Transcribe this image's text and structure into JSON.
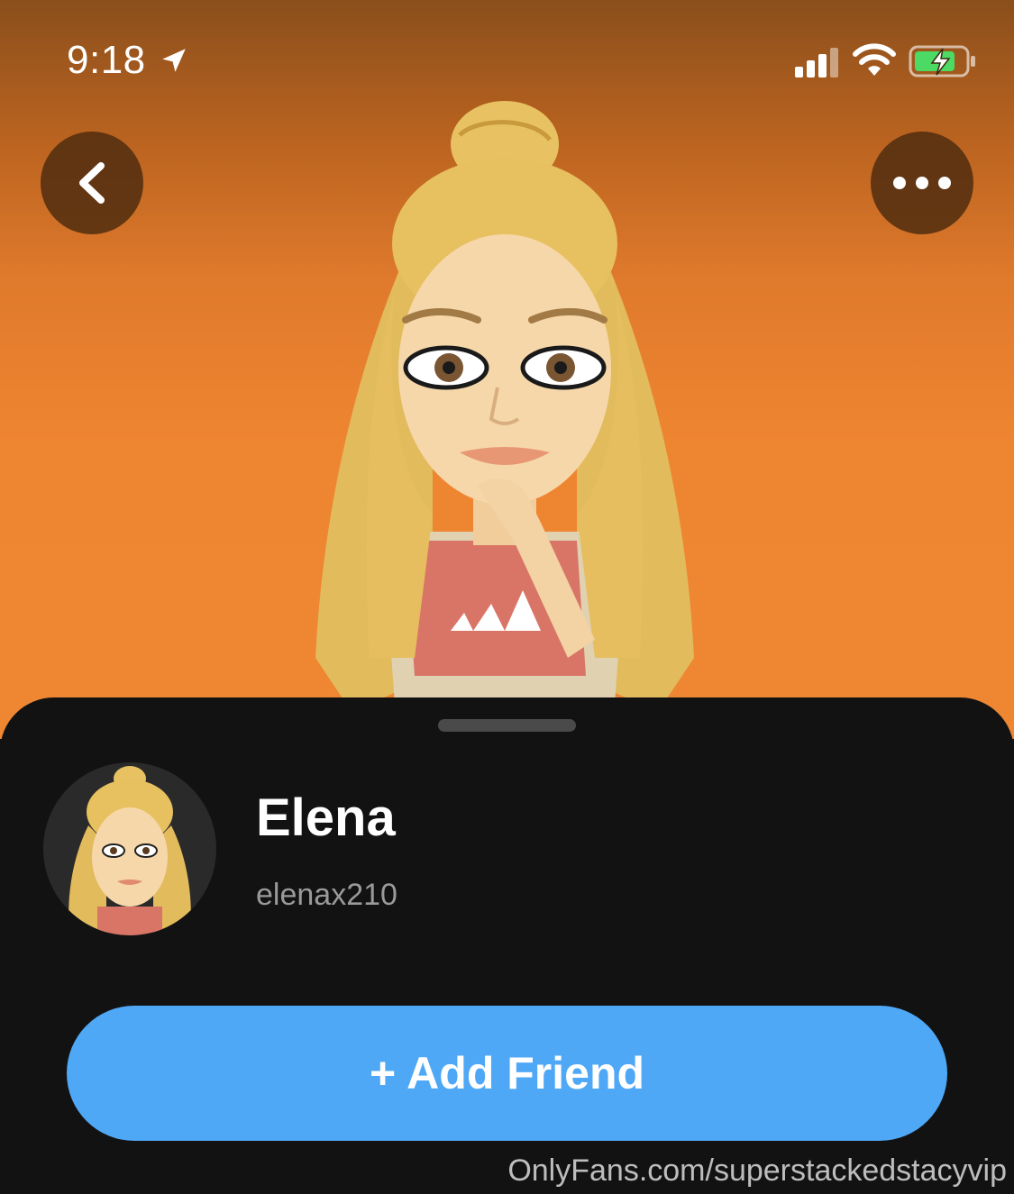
{
  "status_bar": {
    "time": "9:18",
    "icons": [
      "location-arrow-icon",
      "cellular-signal-icon",
      "wifi-icon",
      "battery-charging-icon"
    ]
  },
  "nav": {
    "back_icon": "chevron-left-icon",
    "more_icon": "ellipsis-icon"
  },
  "profile": {
    "display_name": "Elena",
    "username": "elenax210",
    "add_friend_label": "+ Add Friend"
  },
  "watermark": "OnlyFans.com/superstackedstacyvip",
  "colors": {
    "hero_top": "#8a4f1c",
    "hero_bottom": "#ef8632",
    "sheet": "#121212",
    "button": "#4fa8f6",
    "username": "#9a9a9a"
  }
}
